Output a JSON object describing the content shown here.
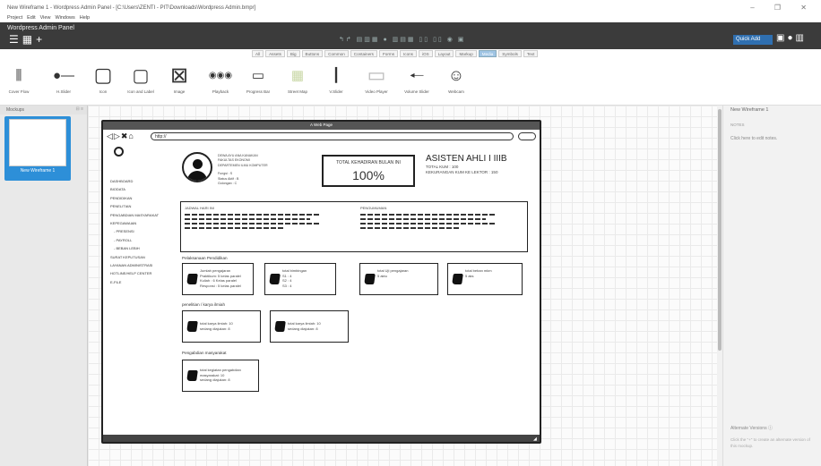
{
  "window": {
    "title": "New Wireframe 1 - Wordpress Admin Panel - [C:\\Users\\ZENTI - PIT\\Downloads\\Wordpress Admin.bmpr]",
    "controls": "– ❐ ✕"
  },
  "menu": {
    "items": [
      "Project",
      "Edit",
      "View",
      "Windows",
      "Help"
    ]
  },
  "app": {
    "name": "Wordpress Admin Panel",
    "quick_add": "Quick Add"
  },
  "filters": [
    "All",
    "Assets",
    "Big",
    "Buttons",
    "Common",
    "Containers",
    "Forms",
    "Icons",
    "iOS",
    "Layout",
    "Markup",
    "Media",
    "Symbols",
    "Text"
  ],
  "active_filter": "Media",
  "library": [
    {
      "label": "Cover Flow",
      "glyph": "⫼"
    },
    {
      "label": "H.Slider",
      "glyph": "●—"
    },
    {
      "label": "Icon",
      "glyph": "▢"
    },
    {
      "label": "Icon and Label",
      "glyph": "▢"
    },
    {
      "label": "Image",
      "glyph": "⊠"
    },
    {
      "label": "Playback",
      "glyph": "◉◉◉"
    },
    {
      "label": "Progress Bar",
      "glyph": "▭"
    },
    {
      "label": "Street Map",
      "glyph": "▦"
    },
    {
      "label": "V.Slider",
      "glyph": "┃"
    },
    {
      "label": "Video Player",
      "glyph": "▭"
    },
    {
      "label": "Volume Slider",
      "glyph": "◂—"
    },
    {
      "label": "Webcam",
      "glyph": "☺"
    }
  ],
  "sidebar": {
    "title": "Mockups",
    "thumb_label": "New Wireframe 1"
  },
  "right_panel": {
    "title": "New Wireframe 1",
    "notes_label": "NOTES",
    "notes_hint": "Click here to edit notes.",
    "alt_title": "Alternate Versions",
    "alt_help": "Click the \"+\" to create an alternate version of this mockup."
  },
  "browser": {
    "title": "A Web Page",
    "url": "http://"
  },
  "nav": {
    "items": [
      "DASHBOARD",
      "BIODATA",
      "PENDIDIKAN",
      "PENELITIAN",
      "PENGABDIAN MASYARAKAT",
      "KEPEGAWAIAN"
    ],
    "subitems": [
      "- PRESENSI",
      "- PAYROLL",
      "- BEBAN LEBIH"
    ],
    "items2": [
      "SURAT KEPUTUSAN",
      "LAYANAN ADMINISTRASI",
      "HOTLINE/HELP CENTER",
      "E-FILE"
    ]
  },
  "profile": {
    "lines": [
      "DEWA AYU ANA KANAKAN",
      "FAKULTAS EKONOMI",
      "DEPARTEMEN ILMU KOMPUTER"
    ],
    "lines2": [
      "Fungsi : S",
      "Status Aktif : B",
      "Golongan : C"
    ]
  },
  "attendance": {
    "title": "TOTAL KEHADIRAN BULAN INI",
    "value": "100%"
  },
  "rank": {
    "title": "ASISTEN AHLI I IIIB",
    "line1": "TOTAL KUM : 100",
    "line2": "KEKURANGAN KUM KE LEKTOR : 150"
  },
  "info": {
    "left_title": "JADWAL HARI INI",
    "right_title": "PENGUMUMAN"
  },
  "sections": {
    "teaching": "Pelaksanaan Pendidikan",
    "research": "penelitian / karya ilmiah",
    "service": "Pengabdian masyarakat"
  },
  "cards": {
    "c1": [
      "Jumlah pengajaran",
      "Praktikum: 5 kelas paralel",
      "Kuliah : 6 Kelas paralel",
      "Responsi : 5 kelas paralel"
    ],
    "c2": [
      "total bimbingan",
      "S1 : 4",
      "S2 : 4",
      "S3 : 4"
    ],
    "c3": [
      "total Uji pengajaran",
      "5 aktu"
    ],
    "c4": [
      "total beban mkm",
      "5 aks"
    ],
    "c5": [
      "total karya ilmiah: 10",
      "sedang diajukan: 8"
    ],
    "c6": [
      "total karya ilmiah: 10",
      "sedang diajukan: 8"
    ],
    "c7": [
      "total kegiatan pengabdian masyarakat: 10",
      "sedang diajukan: 8"
    ]
  }
}
